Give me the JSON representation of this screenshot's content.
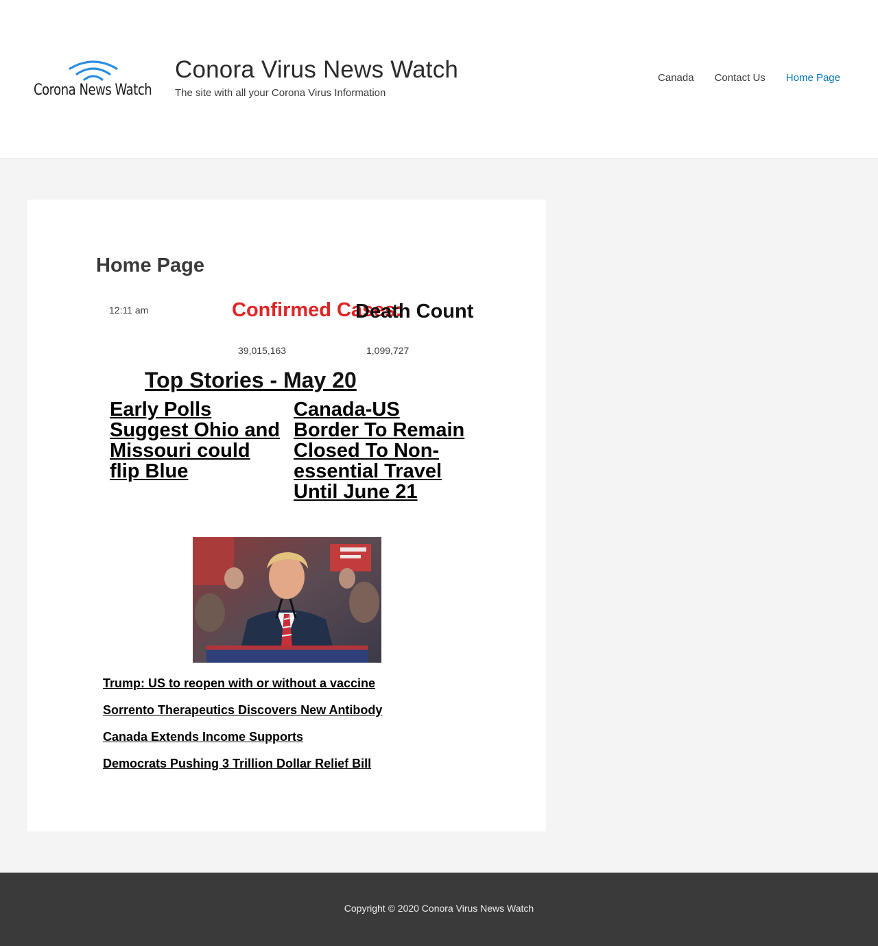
{
  "header": {
    "logo_text": "Corona News Watch",
    "site_title": "Conora Virus News Watch",
    "tagline": "The site with all your Corona Virus Information",
    "nav": [
      {
        "label": "Canada",
        "active": false
      },
      {
        "label": "Contact Us",
        "active": false
      },
      {
        "label": "Home Page",
        "active": true
      }
    ],
    "accent_color": "#0274be",
    "logo_wave_color": "#2a8de0"
  },
  "main": {
    "page_title": "Home Page",
    "time": "12:11 am",
    "stats": {
      "confirmed_label": "Confirmed Cases:",
      "confirmed_value": "39,015,163",
      "confirmed_color": "#e02424",
      "death_label": "Death Count",
      "death_value": "1,099,727"
    },
    "top_stories_title": "Top Stories - May 20",
    "headlines": [
      "Early Polls Suggest Ohio and Missouri could flip Blue",
      "Canada-US Border To Remain Closed To Non-essential Travel Until June 21"
    ],
    "photo_icon": "speaker-at-podium-photo",
    "story_links": [
      "Trump: US to reopen with or without a vaccine",
      "Sorrento Therapeutics Discovers New Antibody",
      "Canada Extends Income Supports",
      "Democrats Pushing 3 Trillion Dollar Relief Bill"
    ]
  },
  "footer": {
    "copyright": "Copyright © 2020 Conora Virus News Watch"
  }
}
